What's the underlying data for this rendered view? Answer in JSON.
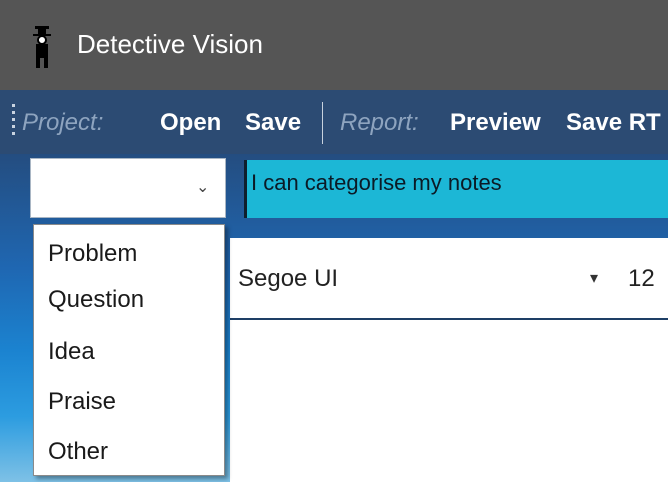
{
  "window": {
    "title": "Detective Vision",
    "icon": "detective-figure-icon"
  },
  "toolbar": {
    "project_label": "Project:",
    "open_label": "Open",
    "save_label": "Save",
    "report_label": "Report:",
    "preview_label": "Preview",
    "save_rtf_label": "Save RT"
  },
  "note": {
    "category_value": "",
    "text": "I can categorise my notes"
  },
  "category_options": [
    "Problem",
    "Question",
    "Idea",
    "Praise",
    "Other"
  ],
  "format": {
    "font_name": "Segoe UI",
    "font_size": "12"
  },
  "colors": {
    "titlebar": "#555555",
    "toolbar": "#2c4b73",
    "note_field": "#1cb7d6"
  }
}
